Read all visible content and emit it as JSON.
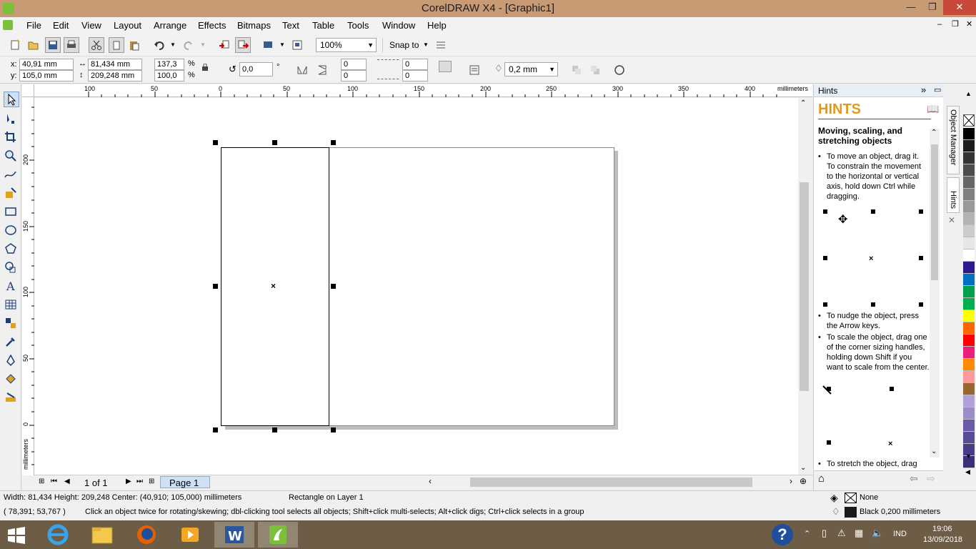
{
  "window": {
    "title": "CorelDRAW X4 - [Graphic1]",
    "min": "—",
    "max": "❐",
    "close": "✕"
  },
  "menu": [
    "File",
    "Edit",
    "View",
    "Layout",
    "Arrange",
    "Effects",
    "Bitmaps",
    "Text",
    "Table",
    "Tools",
    "Window",
    "Help"
  ],
  "toolbar": {
    "zoom": "100%",
    "snap_to": "Snap to"
  },
  "property_bar": {
    "x_label": "x:",
    "x": "40,91 mm",
    "y_label": "y:",
    "y": "105,0 mm",
    "width": "81,434 mm",
    "height": "209,248 mm",
    "scale_x": "137,3",
    "scale_y": "100,0",
    "pct": "%",
    "rotation": "0,0",
    "deg": "°",
    "corner1": "0",
    "corner2": "0",
    "corner3": "0",
    "corner4": "0",
    "outline_width": "0,2 mm"
  },
  "ruler": {
    "top_ticks": [
      "100",
      "50",
      "0",
      "50",
      "100",
      "150",
      "200",
      "250",
      "300",
      "350",
      "400"
    ],
    "units": "millimeters",
    "left_ticks": [
      "200",
      "150",
      "100",
      "50",
      "0"
    ],
    "left_units": "millimeters"
  },
  "page_nav": {
    "pages": "1 of 1",
    "tab": "Page 1"
  },
  "hints": {
    "docker_title": "Hints",
    "heading": "HINTS",
    "topic": "Moving, scaling, and stretching objects",
    "p1": "To move an object, drag it. To constrain the movement to the horizontal or vertical axis, hold down Ctrl while dragging.",
    "p2": "To nudge the object, press the Arrow keys.",
    "p3": "To scale the object, drag one of the corner sizing handles, holding down Shift if you want to scale from the center.",
    "p4": "To stretch the object, drag"
  },
  "docker_tabs": {
    "tab1": "Object Manager",
    "tab2": "Hints"
  },
  "palette": [
    "#000000",
    "#1a1a1a",
    "#333333",
    "#4d4d4d",
    "#666666",
    "#808080",
    "#999999",
    "#b3b3b3",
    "#cccccc",
    "#e6e6e6",
    "#ffffff",
    "#2e1a8c",
    "#0070c0",
    "#00a050",
    "#00b050",
    "#ffff00",
    "#ff6600",
    "#ff0000",
    "#e8207a",
    "#ff8c00",
    "#ff9999",
    "#996633",
    "#b3a0d8",
    "#9b8ec6",
    "#6a5aa8",
    "#5a4b98",
    "#463c88",
    "#3a3078"
  ],
  "status": {
    "line1": "Width: 81,434  Height: 209,248  Center: (40,910; 105,000)  millimeters",
    "object": "Rectangle on Layer 1",
    "coords": "( 78,391; 53,767 )",
    "tip": "Click an object twice for rotating/skewing; dbl-clicking tool selects all objects; Shift+click multi-selects; Alt+click digs; Ctrl+click selects in a group",
    "fill": "None",
    "outline": "Black  0,200 millimeters"
  },
  "taskbar": {
    "lang": "IND",
    "time": "19:06",
    "date": "13/09/2018"
  }
}
